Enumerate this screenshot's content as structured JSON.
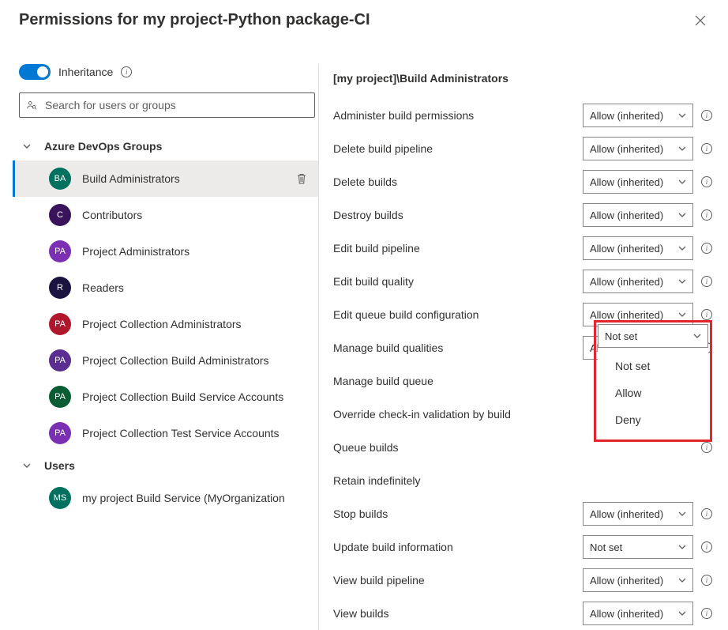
{
  "header": {
    "title": "Permissions for my project-Python package-CI"
  },
  "left": {
    "inheritance_label": "Inheritance",
    "search_placeholder": "Search for users or groups",
    "sections": {
      "groups_title": "Azure DevOps Groups",
      "users_title": "Users"
    },
    "groups": [
      {
        "initials": "BA",
        "label": "Build Administrators",
        "color": "#00715e",
        "selected": true
      },
      {
        "initials": "C",
        "label": "Contributors",
        "color": "#39145c"
      },
      {
        "initials": "PA",
        "label": "Project Administrators",
        "color": "#7b2fb3"
      },
      {
        "initials": "R",
        "label": "Readers",
        "color": "#1b1340"
      },
      {
        "initials": "PA",
        "label": "Project Collection Administrators",
        "color": "#b1172c"
      },
      {
        "initials": "PA",
        "label": "Project Collection Build Administrators",
        "color": "#5b2e91"
      },
      {
        "initials": "PA",
        "label": "Project Collection Build Service Accounts",
        "color": "#0a5c33"
      },
      {
        "initials": "PA",
        "label": "Project Collection Test Service Accounts",
        "color": "#7b2fb3"
      }
    ],
    "users": [
      {
        "initials": "MS",
        "label": "my project Build Service (MyOrganization",
        "color": "#00715e"
      }
    ]
  },
  "right": {
    "title": "[my project]\\Build Administrators",
    "permissions": [
      {
        "label": "Administer build permissions",
        "value": "Allow (inherited)",
        "info": true
      },
      {
        "label": "Delete build pipeline",
        "value": "Allow (inherited)",
        "info": true
      },
      {
        "label": "Delete builds",
        "value": "Allow (inherited)",
        "info": true
      },
      {
        "label": "Destroy builds",
        "value": "Allow (inherited)",
        "info": true
      },
      {
        "label": "Edit build pipeline",
        "value": "Allow (inherited)",
        "info": true
      },
      {
        "label": "Edit build quality",
        "value": "Allow (inherited)",
        "info": true
      },
      {
        "label": "Edit queue build configuration",
        "value": "Allow (inherited)",
        "info": true
      },
      {
        "label": "Manage build qualities",
        "value": "Allow (inherited)",
        "info": true
      },
      {
        "label": "Manage build queue",
        "value": "Not set",
        "open": true,
        "info": false
      },
      {
        "label": "Override check-in validation by build",
        "value": "",
        "info": false,
        "hidden_dd": true
      },
      {
        "label": "Queue builds",
        "value": "",
        "info": true,
        "hidden_dd": true
      },
      {
        "label": "Retain indefinitely",
        "value": "",
        "info": false,
        "hidden_dd": true
      },
      {
        "label": "Stop builds",
        "value": "Allow (inherited)",
        "info": true
      },
      {
        "label": "Update build information",
        "value": "Not set",
        "info": true
      },
      {
        "label": "View build pipeline",
        "value": "Allow (inherited)",
        "info": true
      },
      {
        "label": "View builds",
        "value": "Allow (inherited)",
        "info": true
      }
    ],
    "dd_options": [
      "Not set",
      "Allow",
      "Deny"
    ]
  }
}
